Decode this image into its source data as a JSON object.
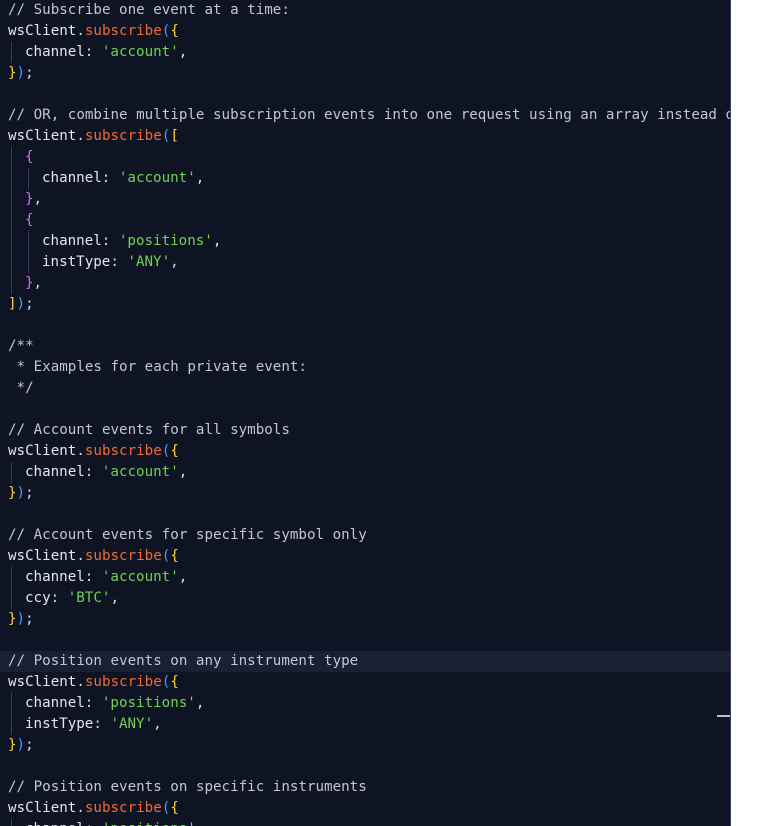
{
  "lines": [
    {
      "indent": 0,
      "tokens": [
        {
          "t": "// Subscribe one event at a time:",
          "c": "comment"
        }
      ]
    },
    {
      "indent": 0,
      "tokens": [
        {
          "t": "wsClient",
          "c": "var"
        },
        {
          "t": ".",
          "c": "punct"
        },
        {
          "t": "subscribe",
          "c": "method"
        },
        {
          "t": "(",
          "c": "b3"
        },
        {
          "t": "{",
          "c": "b1"
        }
      ]
    },
    {
      "indent": 1,
      "tokens": [
        {
          "t": "channel",
          "c": "key"
        },
        {
          "t": ": ",
          "c": "punct"
        },
        {
          "t": "'account'",
          "c": "string"
        },
        {
          "t": ",",
          "c": "punct"
        }
      ]
    },
    {
      "indent": 0,
      "tokens": [
        {
          "t": "}",
          "c": "b1"
        },
        {
          "t": ")",
          "c": "b3"
        },
        {
          "t": ";",
          "c": "punct"
        }
      ]
    },
    {
      "indent": 0,
      "tokens": []
    },
    {
      "indent": 0,
      "tokens": [
        {
          "t": "// OR, combine multiple subscription events into one request using an array instead of",
          "c": "comment"
        }
      ]
    },
    {
      "indent": 0,
      "tokens": [
        {
          "t": "wsClient",
          "c": "var"
        },
        {
          "t": ".",
          "c": "punct"
        },
        {
          "t": "subscribe",
          "c": "method"
        },
        {
          "t": "(",
          "c": "b3"
        },
        {
          "t": "[",
          "c": "b1"
        }
      ]
    },
    {
      "indent": 1,
      "tokens": [
        {
          "t": "{",
          "c": "b2"
        }
      ]
    },
    {
      "indent": 2,
      "tokens": [
        {
          "t": "channel",
          "c": "key"
        },
        {
          "t": ": ",
          "c": "punct"
        },
        {
          "t": "'account'",
          "c": "string"
        },
        {
          "t": ",",
          "c": "punct"
        }
      ]
    },
    {
      "indent": 1,
      "tokens": [
        {
          "t": "}",
          "c": "b2"
        },
        {
          "t": ",",
          "c": "punct"
        }
      ]
    },
    {
      "indent": 1,
      "tokens": [
        {
          "t": "{",
          "c": "b2"
        }
      ]
    },
    {
      "indent": 2,
      "tokens": [
        {
          "t": "channel",
          "c": "key"
        },
        {
          "t": ": ",
          "c": "punct"
        },
        {
          "t": "'positions'",
          "c": "string"
        },
        {
          "t": ",",
          "c": "punct"
        }
      ]
    },
    {
      "indent": 2,
      "tokens": [
        {
          "t": "instType",
          "c": "key"
        },
        {
          "t": ": ",
          "c": "punct"
        },
        {
          "t": "'ANY'",
          "c": "string"
        },
        {
          "t": ",",
          "c": "punct"
        }
      ]
    },
    {
      "indent": 1,
      "tokens": [
        {
          "t": "}",
          "c": "b2"
        },
        {
          "t": ",",
          "c": "punct"
        }
      ]
    },
    {
      "indent": 0,
      "tokens": [
        {
          "t": "]",
          "c": "b1"
        },
        {
          "t": ")",
          "c": "b3"
        },
        {
          "t": ";",
          "c": "punct"
        }
      ]
    },
    {
      "indent": 0,
      "tokens": []
    },
    {
      "indent": 0,
      "tokens": [
        {
          "t": "/**",
          "c": "comment"
        }
      ]
    },
    {
      "indent": 0,
      "tokens": [
        {
          "t": " * Examples for each private event:",
          "c": "comment"
        }
      ]
    },
    {
      "indent": 0,
      "tokens": [
        {
          "t": " */",
          "c": "comment"
        }
      ]
    },
    {
      "indent": 0,
      "tokens": []
    },
    {
      "indent": 0,
      "tokens": [
        {
          "t": "// Account events for all symbols",
          "c": "comment"
        }
      ]
    },
    {
      "indent": 0,
      "tokens": [
        {
          "t": "wsClient",
          "c": "var"
        },
        {
          "t": ".",
          "c": "punct"
        },
        {
          "t": "subscribe",
          "c": "method"
        },
        {
          "t": "(",
          "c": "b3"
        },
        {
          "t": "{",
          "c": "b1"
        }
      ]
    },
    {
      "indent": 1,
      "tokens": [
        {
          "t": "channel",
          "c": "key"
        },
        {
          "t": ": ",
          "c": "punct"
        },
        {
          "t": "'account'",
          "c": "string"
        },
        {
          "t": ",",
          "c": "punct"
        }
      ]
    },
    {
      "indent": 0,
      "tokens": [
        {
          "t": "}",
          "c": "b1"
        },
        {
          "t": ")",
          "c": "b3"
        },
        {
          "t": ";",
          "c": "punct"
        }
      ]
    },
    {
      "indent": 0,
      "tokens": []
    },
    {
      "indent": 0,
      "tokens": [
        {
          "t": "// Account events for specific symbol only",
          "c": "comment"
        }
      ]
    },
    {
      "indent": 0,
      "tokens": [
        {
          "t": "wsClient",
          "c": "var"
        },
        {
          "t": ".",
          "c": "punct"
        },
        {
          "t": "subscribe",
          "c": "method"
        },
        {
          "t": "(",
          "c": "b3"
        },
        {
          "t": "{",
          "c": "b1"
        }
      ]
    },
    {
      "indent": 1,
      "tokens": [
        {
          "t": "channel",
          "c": "key"
        },
        {
          "t": ": ",
          "c": "punct"
        },
        {
          "t": "'account'",
          "c": "string"
        },
        {
          "t": ",",
          "c": "punct"
        }
      ]
    },
    {
      "indent": 1,
      "tokens": [
        {
          "t": "ccy",
          "c": "key"
        },
        {
          "t": ": ",
          "c": "punct"
        },
        {
          "t": "'BTC'",
          "c": "string"
        },
        {
          "t": ",",
          "c": "punct"
        }
      ]
    },
    {
      "indent": 0,
      "tokens": [
        {
          "t": "}",
          "c": "b1"
        },
        {
          "t": ")",
          "c": "b3"
        },
        {
          "t": ";",
          "c": "punct"
        }
      ]
    },
    {
      "indent": 0,
      "tokens": []
    },
    {
      "indent": 0,
      "highlight": true,
      "tokens": [
        {
          "t": "// Position events on any instrument type",
          "c": "comment"
        }
      ]
    },
    {
      "indent": 0,
      "tokens": [
        {
          "t": "wsClient",
          "c": "var"
        },
        {
          "t": ".",
          "c": "punct"
        },
        {
          "t": "subscribe",
          "c": "method"
        },
        {
          "t": "(",
          "c": "b3"
        },
        {
          "t": "{",
          "c": "b1"
        }
      ]
    },
    {
      "indent": 1,
      "tokens": [
        {
          "t": "channel",
          "c": "key"
        },
        {
          "t": ": ",
          "c": "punct"
        },
        {
          "t": "'positions'",
          "c": "string"
        },
        {
          "t": ",",
          "c": "punct"
        }
      ]
    },
    {
      "indent": 1,
      "tokens": [
        {
          "t": "instType",
          "c": "key"
        },
        {
          "t": ": ",
          "c": "punct"
        },
        {
          "t": "'ANY'",
          "c": "string"
        },
        {
          "t": ",",
          "c": "punct"
        }
      ]
    },
    {
      "indent": 0,
      "tokens": [
        {
          "t": "}",
          "c": "b1"
        },
        {
          "t": ")",
          "c": "b3"
        },
        {
          "t": ";",
          "c": "punct"
        }
      ]
    },
    {
      "indent": 0,
      "tokens": []
    },
    {
      "indent": 0,
      "tokens": [
        {
          "t": "// Position events on specific instruments",
          "c": "comment"
        }
      ]
    },
    {
      "indent": 0,
      "tokens": [
        {
          "t": "wsClient",
          "c": "var"
        },
        {
          "t": ".",
          "c": "punct"
        },
        {
          "t": "subscribe",
          "c": "method"
        },
        {
          "t": "(",
          "c": "b3"
        },
        {
          "t": "{",
          "c": "b1"
        }
      ]
    },
    {
      "indent": 1,
      "tokens": [
        {
          "t": "channel",
          "c": "key"
        },
        {
          "t": ": ",
          "c": "punct"
        },
        {
          "t": "'positions'",
          "c": "string"
        },
        {
          "t": ",",
          "c": "punct"
        }
      ]
    }
  ]
}
